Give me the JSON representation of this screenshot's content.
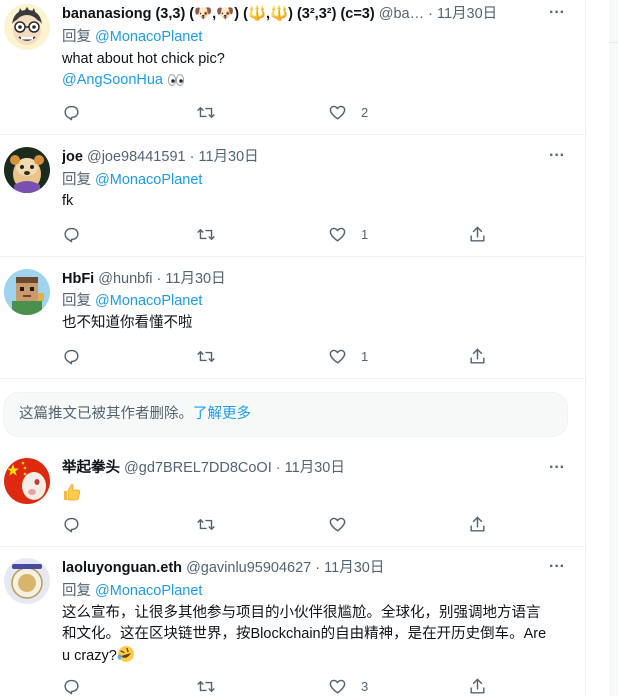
{
  "colors": {
    "accent": "#1d9bf0",
    "secondary_text": "#536471",
    "primary_text": "#0f1419",
    "border": "#eff3f4",
    "notice_bg": "#f7f9f9"
  },
  "icons": {
    "reply": "speech-bubble-icon",
    "retweet": "retweet-arrows-icon",
    "like": "heart-outline-icon",
    "share": "share-upload-icon",
    "more": "three-dots-icon"
  },
  "reply_prefix": "回复",
  "tweets": [
    {
      "name": "bananasiong (3,3) (🐶,🐶) (🔱,🔱) (3²,3²) (c=3)",
      "handle": "@ba…",
      "time": "11月30日",
      "replying_to": "@MonacoPlanet",
      "text": "what about hot chick pic?",
      "mention_line": "@AngSoonHua",
      "mention_emoji": "eyes-emoji",
      "likes": "2",
      "has_share": false
    },
    {
      "name": "joe",
      "handle": "@joe98441591",
      "time": "11月30日",
      "replying_to": "@MonacoPlanet",
      "text": "fk",
      "likes": "1",
      "has_share": true
    },
    {
      "name": "HbFi",
      "handle": "@hunbfi",
      "time": "11月30日",
      "replying_to": "@MonacoPlanet",
      "text": "也不知道你看懂不啦",
      "likes": "1",
      "has_share": true
    },
    {
      "name": "举起拳头",
      "handle": "@gd7BREL7DD8CoOI",
      "time": "11月30日",
      "text_emoji": "thumbs-up-emoji",
      "likes": "",
      "has_share": true
    },
    {
      "name": "laoluyonguan.eth",
      "handle": "@gavinlu95904627",
      "time": "11月30日",
      "replying_to": "@MonacoPlanet",
      "text_lines": [
        "这么宣布，让很多其他参与项目的小伙伴很尴尬。全球化，别强调地方语言",
        "和文化。这在区块链世界，按Blockchain的自由精神，是在开历史倒车。Are",
        "u crazy?"
      ],
      "text_emoji": "rolling-laughing-emoji",
      "likes": "3",
      "has_share": true
    }
  ],
  "deleted_notice": {
    "text": "这篇推文已被其作者删除。",
    "link": "了解更多"
  }
}
